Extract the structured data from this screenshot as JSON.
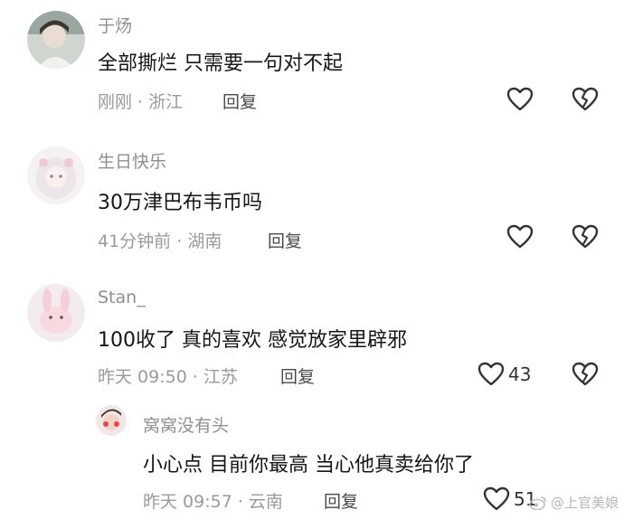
{
  "comments": [
    {
      "username": "于炀",
      "text": "全部撕烂 只需要一句对不起",
      "time": "刚刚",
      "location": "浙江",
      "reply_label": "回复",
      "likes": ""
    },
    {
      "username": "生日快乐",
      "text": "30万津巴布韦币吗",
      "time": "41分钟前",
      "location": "湖南",
      "reply_label": "回复",
      "likes": ""
    },
    {
      "username": "Stan_",
      "text": "100收了 真的喜欢 感觉放家里辟邪",
      "time": "昨天 09:50",
      "location": "江苏",
      "reply_label": "回复",
      "likes": "43"
    }
  ],
  "reply": {
    "username": "窝窝没有头",
    "text": "小心点 目前你最高 当心他真卖给你了",
    "time": "昨天 09:57",
    "location": "云南",
    "reply_label": "回复",
    "likes": "51"
  },
  "watermark": "@上官美娘",
  "colors": {
    "text": "#161616",
    "muted": "#9a9a9a",
    "icon": "#333333"
  },
  "icons": [
    "heart-outline-icon",
    "broken-heart-icon",
    "weibo-logo"
  ]
}
